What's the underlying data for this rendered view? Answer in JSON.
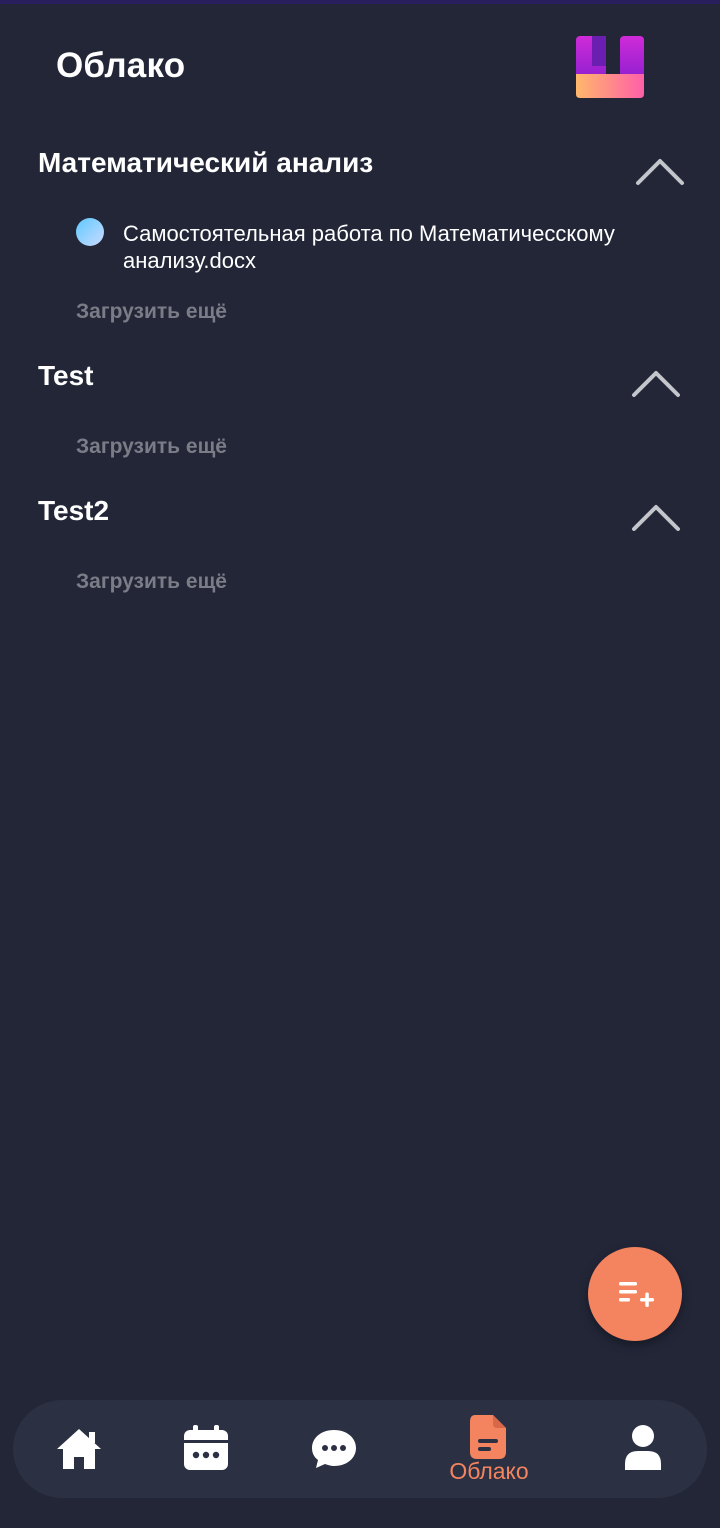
{
  "header": {
    "title": "Облако"
  },
  "sections": [
    {
      "title": "Математический анализ",
      "files": [
        {
          "name": "Самостоятельная работа по Математичесскому анализу.docx"
        }
      ],
      "load_more": "Загрузить ещё"
    },
    {
      "title": "Test",
      "files": [],
      "load_more": "Загрузить ещё"
    },
    {
      "title": "Test2",
      "files": [],
      "load_more": "Загрузить ещё"
    }
  ],
  "bottom_nav": {
    "items": [
      {
        "icon": "home-icon"
      },
      {
        "icon": "calendar-icon"
      },
      {
        "icon": "chat-icon"
      },
      {
        "icon": "document-icon",
        "label": "Облако",
        "active": true
      },
      {
        "icon": "user-icon"
      }
    ]
  },
  "colors": {
    "background": "#222637",
    "nav_background": "#2b3042",
    "accent": "#f4845f",
    "muted_text": "#7a7d87"
  },
  "fab": {
    "icon": "add-list-icon"
  }
}
